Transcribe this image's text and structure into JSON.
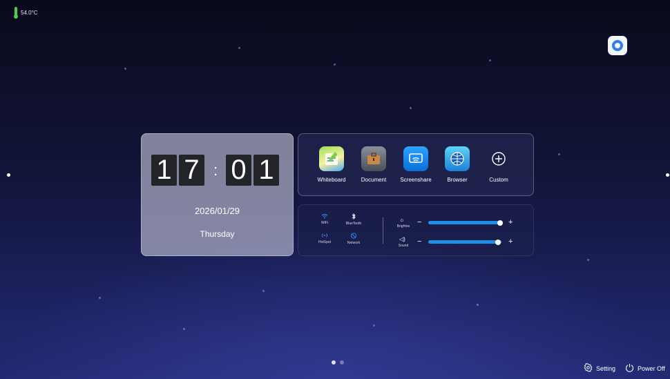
{
  "status": {
    "temperature": "54.0°C"
  },
  "clock": {
    "hour_1": "1",
    "hour_2": "7",
    "separator": ":",
    "minute_1": "0",
    "minute_2": "1",
    "date": "2026/01/29",
    "weekday": "Thursday"
  },
  "apps": [
    {
      "label": "Whiteboard",
      "icon": "whiteboard-icon"
    },
    {
      "label": "Document",
      "icon": "briefcase-icon"
    },
    {
      "label": "Screenshare",
      "icon": "screenshare-icon"
    },
    {
      "label": "Browser",
      "icon": "globe-icon"
    },
    {
      "label": "Custom",
      "icon": "plus-circle-icon"
    }
  ],
  "quick_settings": [
    {
      "label": "WiFi",
      "icon": "wifi-icon"
    },
    {
      "label": "BlueTooth",
      "icon": "bluetooth-icon"
    },
    {
      "label": "HotSpot",
      "icon": "hotspot-icon"
    },
    {
      "label": "Network",
      "icon": "network-icon"
    }
  ],
  "sliders": {
    "brightness": {
      "label": "Brightne",
      "minus": "−",
      "plus": "+",
      "level": 1.0
    },
    "sound": {
      "label": "Sound",
      "minus": "−",
      "plus": "+",
      "level": 0.95
    }
  },
  "footer": {
    "setting_label": "Setting",
    "power_label": "Power Off",
    "pages": 2,
    "current_page": 1
  },
  "colors": {
    "accent": "#1e8fe6",
    "quick_icon": "#3d8bff",
    "temperature": "#4cd04c"
  }
}
